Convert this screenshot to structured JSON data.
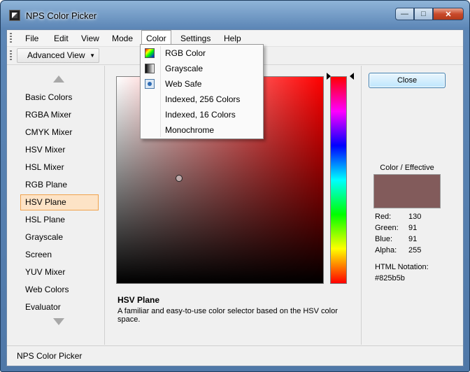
{
  "window": {
    "title": "NPS Color Picker"
  },
  "menubar": {
    "items": [
      "File",
      "Edit",
      "View",
      "Mode",
      "Color",
      "Settings",
      "Help"
    ],
    "open_menu": "Color"
  },
  "toolbar": {
    "view_button": "Advanced View"
  },
  "color_menu": {
    "items": [
      {
        "label": "RGB Color",
        "icon": "rgb-color-icon"
      },
      {
        "label": "Grayscale",
        "icon": "grayscale-icon"
      },
      {
        "label": "Web Safe",
        "icon": "web-safe-icon"
      },
      {
        "label": "Indexed, 256 Colors",
        "icon": ""
      },
      {
        "label": "Indexed, 16 Colors",
        "icon": ""
      },
      {
        "label": "Monochrome",
        "icon": ""
      }
    ]
  },
  "sidebar": {
    "items": [
      "Basic Colors",
      "RGBA Mixer",
      "CMYK Mixer",
      "HSV Mixer",
      "HSL Mixer",
      "RGB Plane",
      "HSV Plane",
      "HSL Plane",
      "Grayscale",
      "Screen",
      "YUV Mixer",
      "Web Colors",
      "Evaluator"
    ],
    "selected": "HSV Plane"
  },
  "picker": {
    "hue_color": "#ff0000",
    "saturation": 0.3,
    "value": 0.51,
    "hue_marker_position": 0
  },
  "description": {
    "title": "HSV Plane",
    "text": "A familiar and easy-to-use color selector based on the HSV color space."
  },
  "right_panel": {
    "close_label": "Close",
    "swatch_label": "Color / Effective",
    "swatch_color": "#825b5b",
    "rgba": [
      {
        "label": "Red:",
        "value": "130"
      },
      {
        "label": "Green:",
        "value": "91"
      },
      {
        "label": "Blue:",
        "value": "91"
      },
      {
        "label": "Alpha:",
        "value": "255"
      }
    ],
    "html_label": "HTML Notation:",
    "html_value": "#825b5b"
  },
  "status": {
    "text": "NPS Color Picker"
  }
}
